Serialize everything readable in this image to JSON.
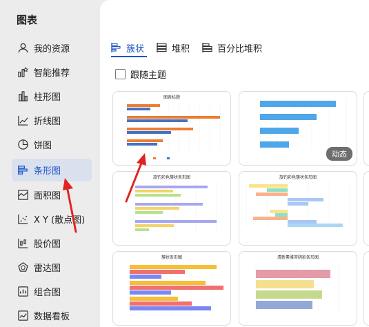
{
  "sidebar": {
    "title": "图表",
    "items": [
      {
        "label": "我的资源",
        "icon": "user-icon"
      },
      {
        "label": "智能推荐",
        "icon": "smart-recommend-icon"
      },
      {
        "label": "柱形图",
        "icon": "column-chart-icon"
      },
      {
        "label": "折线图",
        "icon": "line-chart-icon"
      },
      {
        "label": "饼图",
        "icon": "pie-chart-icon"
      },
      {
        "label": "条形图",
        "icon": "bar-chart-icon",
        "active": true
      },
      {
        "label": "面积图",
        "icon": "area-chart-icon"
      },
      {
        "label": "X Y (散点图)",
        "icon": "scatter-chart-icon"
      },
      {
        "label": "股价图",
        "icon": "stock-chart-icon"
      },
      {
        "label": "雷达图",
        "icon": "radar-chart-icon"
      },
      {
        "label": "组合图",
        "icon": "combo-chart-icon"
      },
      {
        "label": "数据看板",
        "icon": "dashboard-icon"
      }
    ]
  },
  "tabs": [
    {
      "label": "簇状",
      "icon": "clustered-bar-icon",
      "active": true
    },
    {
      "label": "堆积",
      "icon": "stacked-bar-icon"
    },
    {
      "label": "百分比堆积",
      "icon": "percent-stacked-bar-icon"
    }
  ],
  "follow_theme": {
    "label": "跟随主题",
    "checked": false
  },
  "cards": [
    {
      "title": "图表标题"
    },
    {
      "badge": "动态"
    },
    {
      "title": "旋钓彩色簇状条形图"
    },
    {
      "title": "旋钓彩色簇状条形图"
    },
    {
      "title": "簇状条形图"
    },
    {
      "title": "清新素雅带阴影条形图"
    }
  ],
  "colors": {
    "accent": "#1f55c8",
    "active_bg": "#d9e0ee",
    "annotation": "#e02424",
    "bar_orange": "#ed7d31",
    "bar_blue": "#4472c4"
  }
}
